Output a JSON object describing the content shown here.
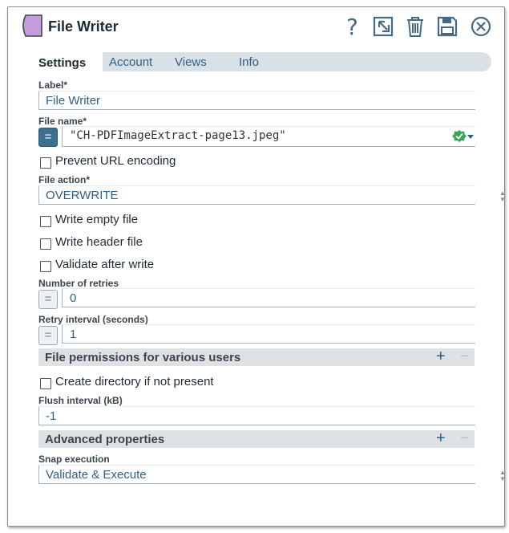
{
  "header": {
    "title": "File Writer",
    "icons": [
      "help-icon",
      "popout-icon",
      "trash-icon",
      "save-icon",
      "close-icon"
    ]
  },
  "tabs": [
    {
      "label": "Settings",
      "active": true
    },
    {
      "label": "Account"
    },
    {
      "label": "Views"
    },
    {
      "label": "Info"
    }
  ],
  "fields": {
    "label": {
      "label": "Label*",
      "value": "File Writer"
    },
    "file_name": {
      "label": "File name*",
      "value": "\"CH-PDFImageExtract-page13.jpeg\""
    },
    "prevent_url": {
      "label": "Prevent URL encoding",
      "checked": false
    },
    "file_action": {
      "label": "File action*",
      "value": "OVERWRITE"
    },
    "write_empty": {
      "label": "Write empty file",
      "checked": false
    },
    "write_header": {
      "label": "Write header file",
      "checked": false
    },
    "validate_after": {
      "label": "Validate after write",
      "checked": false
    },
    "retries": {
      "label": "Number of retries",
      "value": "0"
    },
    "retry_interval": {
      "label": "Retry interval (seconds)",
      "value": "1"
    },
    "permissions": {
      "label": "File permissions for various users"
    },
    "create_dir": {
      "label": "Create directory if not present",
      "checked": false
    },
    "flush": {
      "label": "Flush interval (kB)",
      "value": "-1"
    },
    "advanced": {
      "label": "Advanced properties"
    },
    "snap_exec": {
      "label": "Snap execution",
      "value": "Validate & Execute"
    }
  },
  "expr_symbol": "=",
  "colors": {
    "accent": "#2f5f84",
    "snap_icon": "#c59be0",
    "valid": "#3aa655",
    "tab_bar": "#d9e1e6"
  }
}
